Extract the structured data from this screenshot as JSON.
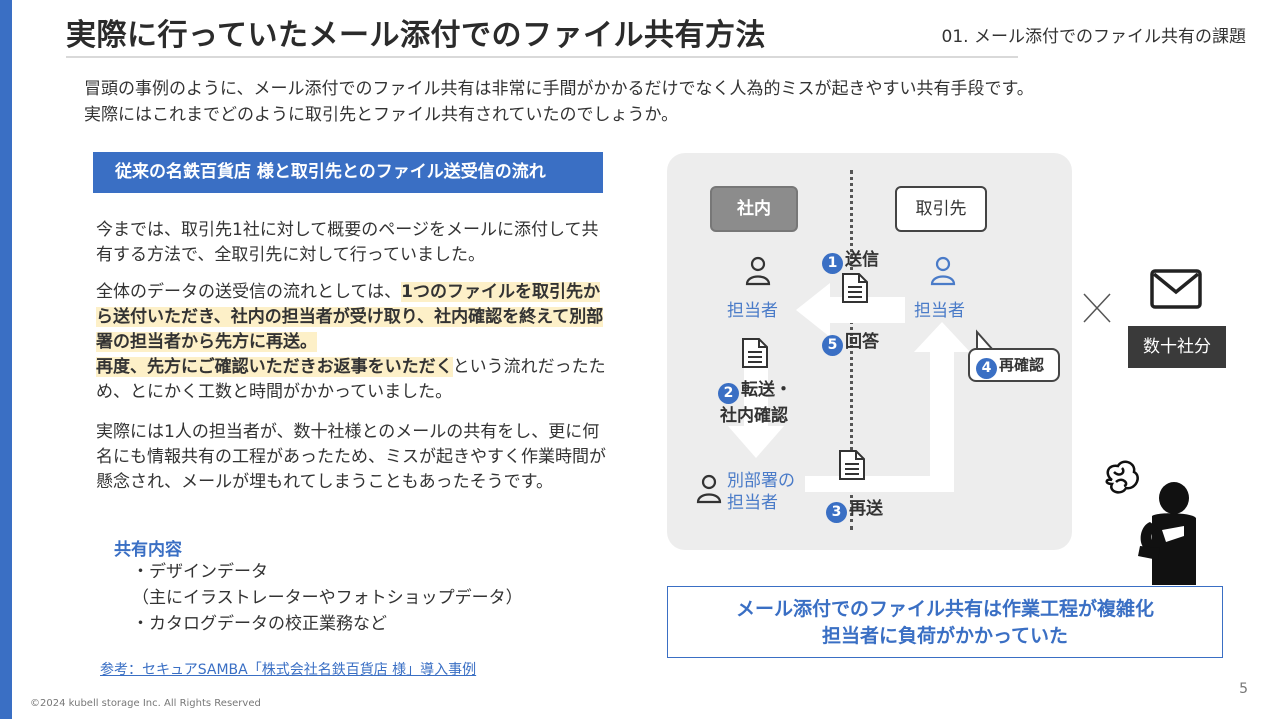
{
  "header": {
    "title": "実際に行っていたメール添付でのファイル共有方法",
    "section": "01. メール添付でのファイル共有の課題"
  },
  "intro": {
    "line1": "冒頭の事例のように、メール添付でのファイル共有は非常に手間がかかるだけでなく人為的ミスが起きやすい共有手段です。",
    "line2": "実際にはこれまでどのように取引先とファイル共有されていたのでしょうか。"
  },
  "left": {
    "header": "従来の名鉄百貨店 様と取引先とのファイル送受信の流れ",
    "p1": "今までは、取引先1社に対して概要のページをメールに添付して共有する方法で、全取引先に対して行っていました。",
    "p2_pre": "全体のデータの送受信の流れとしては、",
    "p2_hl1": "1つのファイルを取引先から送付いただき、社内の担当者が受け取り、社内確認を終えて別部署の担当者から先方に再送。",
    "p2_hl2": "再度、先方にご確認いただきお返事をいただく",
    "p2_post": "という流れだったため、とにかく工数と時間がかかっていました。",
    "p3": "実際には1人の担当者が、数十社様とのメールの共有をし、更に何名にも情報共有の工程があったため、ミスが起きやすく作業時間が懸念され、メールが埋もれてしまうこともあったそうです。",
    "share_title": "共有内容",
    "share_items": [
      "・デザインデータ",
      "（主にイラストレーターやフォトショップデータ）",
      "・カタログデータの校正業務など"
    ],
    "reference": "参考：セキュアSAMBA「株式会社名鉄百貨店 様」導入事例"
  },
  "diagram": {
    "internal": "社内",
    "partner": "取引先",
    "person_internal": "担当者",
    "person_partner": "担当者",
    "person_other_l1": "別部署の",
    "person_other_l2": "担当者",
    "steps": {
      "s1_num": "1",
      "s1": "送信",
      "s5_num": "5",
      "s5": "回答",
      "s2_num": "2",
      "s2_l1": "転送・",
      "s2_l2": "社内確認",
      "s3_num": "3",
      "s3": "再送",
      "s4_num": "4",
      "s4": "再確認"
    },
    "times_count": "数十社分"
  },
  "summary": {
    "line1": "メール添付でのファイル共有は作業工程が複雑化",
    "line2": "担当者に負荷がかかっていた"
  },
  "footer": {
    "copyright": "©2024 kubell storage Inc. All Rights Reserved",
    "page": "5"
  },
  "colors": {
    "accent": "#3a6fc4",
    "highlight": "#fdf0c8",
    "panel": "#ededed"
  }
}
